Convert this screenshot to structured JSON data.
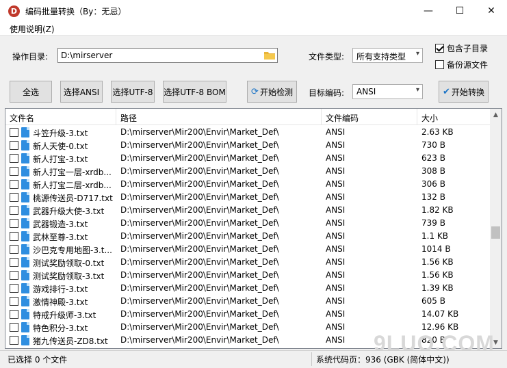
{
  "window": {
    "title": "编码批量转换（By：无忌）",
    "icon_letter": "D",
    "minimize": "—",
    "maximize": "☐",
    "close": "✕"
  },
  "menu": {
    "help": "使用说明(Z)"
  },
  "controls": {
    "dir_label": "操作目录:",
    "dir_value": "D:\\mirserver",
    "filetype_label": "文件类型:",
    "filetype_value": "所有支持类型",
    "include_subdirs": "包含子目录",
    "include_subdirs_checked": true,
    "backup_source": "备份源文件",
    "backup_source_checked": false,
    "target_label": "目标编码:",
    "target_value": "ANSI"
  },
  "buttons": {
    "select_all": "全选",
    "select_ansi": "选择ANSI",
    "select_utf8": "选择UTF-8",
    "select_utf8bom": "选择UTF-8 BOM",
    "start_detect": "开始检测",
    "start_convert": "开始转换"
  },
  "table": {
    "headers": [
      "文件名",
      "路径",
      "文件编码",
      "大小"
    ],
    "rows": [
      {
        "name": "斗笠升级-3.txt",
        "path": "D:\\mirserver\\Mir200\\Envir\\Market_Def\\",
        "enc": "ANSI",
        "size": "2.63 KB"
      },
      {
        "name": "新人天使-0.txt",
        "path": "D:\\mirserver\\Mir200\\Envir\\Market_Def\\",
        "enc": "ANSI",
        "size": "730 B"
      },
      {
        "name": "新人打宝-3.txt",
        "path": "D:\\mirserver\\Mir200\\Envir\\Market_Def\\",
        "enc": "ANSI",
        "size": "623 B"
      },
      {
        "name": "新人打宝一层-xrdb...",
        "path": "D:\\mirserver\\Mir200\\Envir\\Market_Def\\",
        "enc": "ANSI",
        "size": "308 B"
      },
      {
        "name": "新人打宝二层-xrdb...",
        "path": "D:\\mirserver\\Mir200\\Envir\\Market_Def\\",
        "enc": "ANSI",
        "size": "306 B"
      },
      {
        "name": "桃源传送员-D717.txt",
        "path": "D:\\mirserver\\Mir200\\Envir\\Market_Def\\",
        "enc": "ANSI",
        "size": "132 B"
      },
      {
        "name": "武器升级大使-3.txt",
        "path": "D:\\mirserver\\Mir200\\Envir\\Market_Def\\",
        "enc": "ANSI",
        "size": "1.82 KB"
      },
      {
        "name": "武器锻造-3.txt",
        "path": "D:\\mirserver\\Mir200\\Envir\\Market_Def\\",
        "enc": "ANSI",
        "size": "739 B"
      },
      {
        "name": "武林至尊-3.txt",
        "path": "D:\\mirserver\\Mir200\\Envir\\Market_Def\\",
        "enc": "ANSI",
        "size": "1.1 KB"
      },
      {
        "name": "沙巴克专用地图-3.t...",
        "path": "D:\\mirserver\\Mir200\\Envir\\Market_Def\\",
        "enc": "ANSI",
        "size": "1014 B"
      },
      {
        "name": "测试奖励领取-0.txt",
        "path": "D:\\mirserver\\Mir200\\Envir\\Market_Def\\",
        "enc": "ANSI",
        "size": "1.56 KB"
      },
      {
        "name": "测试奖励领取-3.txt",
        "path": "D:\\mirserver\\Mir200\\Envir\\Market_Def\\",
        "enc": "ANSI",
        "size": "1.56 KB"
      },
      {
        "name": "游戏排行-3.txt",
        "path": "D:\\mirserver\\Mir200\\Envir\\Market_Def\\",
        "enc": "ANSI",
        "size": "1.39 KB"
      },
      {
        "name": "激情神殿-3.txt",
        "path": "D:\\mirserver\\Mir200\\Envir\\Market_Def\\",
        "enc": "ANSI",
        "size": "605 B"
      },
      {
        "name": "特戒升级师-3.txt",
        "path": "D:\\mirserver\\Mir200\\Envir\\Market_Def\\",
        "enc": "ANSI",
        "size": "14.07 KB"
      },
      {
        "name": "特色积分-3.txt",
        "path": "D:\\mirserver\\Mir200\\Envir\\Market_Def\\",
        "enc": "ANSI",
        "size": "12.96 KB"
      },
      {
        "name": "猪九传送员-ZD8.txt",
        "path": "D:\\mirserver\\Mir200\\Envir\\Market_Def\\",
        "enc": "ANSI",
        "size": "820 B"
      }
    ]
  },
  "status": {
    "selected": "已选择 0 个文件",
    "codepage": "系统代码页：936 (GBK (简体中文))"
  },
  "watermark": "9LUO.COM"
}
